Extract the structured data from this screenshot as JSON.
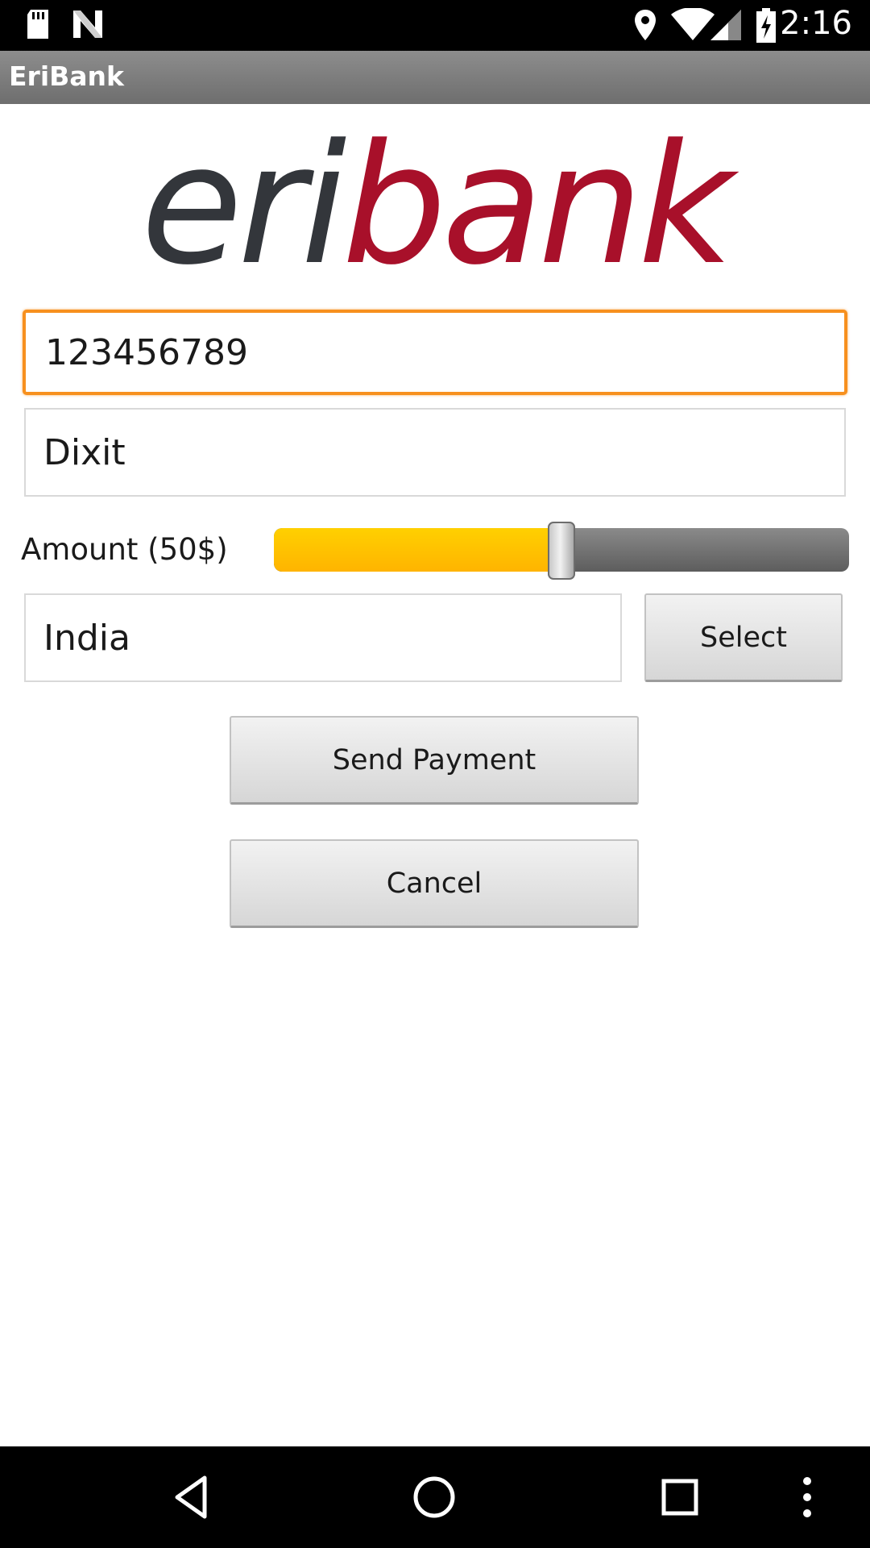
{
  "status_bar": {
    "time": "2:16",
    "icons": [
      "sd-card-icon",
      "n-notification-icon",
      "location-icon",
      "wifi-icon",
      "cell-signal-icon",
      "battery-charging-icon"
    ]
  },
  "app": {
    "title": "EriBank"
  },
  "logo": {
    "text_dark": "eri",
    "text_red": "bank",
    "colors": {
      "dark": "#33363b",
      "red": "#a8102a"
    }
  },
  "form": {
    "phone_value": "123456789",
    "name_value": "Dixit",
    "amount_label": "Amount (50$)",
    "amount_fraction": 0.5,
    "country_value": "India",
    "select_label": "Select",
    "send_label": "Send Payment",
    "cancel_label": "Cancel"
  },
  "colors": {
    "focus_border": "#f7901e",
    "slider_fill": "#ffc000",
    "slider_track": "#6e6e6e"
  },
  "nav_bar": {
    "buttons": [
      "back-icon",
      "home-icon",
      "recents-icon",
      "overflow-menu-icon"
    ]
  }
}
